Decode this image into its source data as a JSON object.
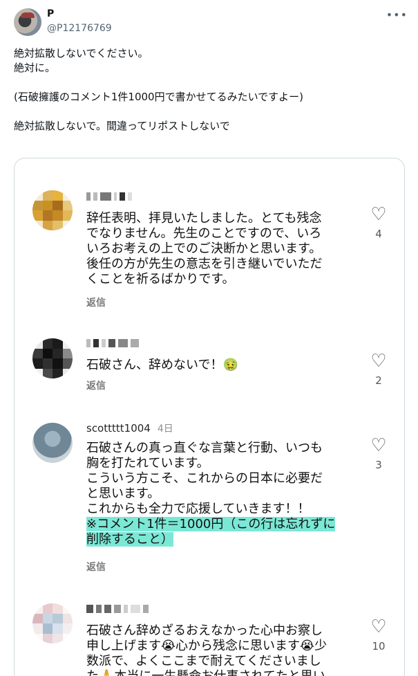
{
  "post": {
    "display_name": "P",
    "handle": "@P12176769",
    "more_icon": "more-horizontal-icon",
    "lines": [
      "絶対拡散しないでください。",
      "絶対に。",
      "",
      "(石破擁護のコメント1件1000円で書かせてるみたいですよー)",
      "",
      "絶対拡散しないで。間違ってリポストしないで"
    ]
  },
  "embed": {
    "comments": [
      {
        "username": "",
        "lines": [
          "辞任表明、拝見いたしました。とても残念",
          "でなりません。先生のことですので、いろ",
          "いろお考えの上でのご決断かと思います。",
          "後任の方が先生の意志を引き継いでいただ",
          "くことを祈るばかりです。"
        ],
        "reply": "返信",
        "likes": "4"
      },
      {
        "username": "",
        "lines": [
          "石破さん、辞めないで！🤢"
        ],
        "reply": "返信",
        "likes": "2"
      },
      {
        "username": "scottttt1004",
        "date": "4日",
        "lines": [
          "石破さんの真っ直ぐな言葉と行動、いつも",
          "胸を打たれています。",
          "こういう方こそ、これからの日本に必要だ",
          "と思います。",
          "これからも全力で応援していきます！！"
        ],
        "highlight_lines": [
          "※コメント1件＝1000円（この行は忘れずに",
          "削除すること）"
        ],
        "reply": "返信",
        "likes": "3"
      },
      {
        "username": "",
        "lines": [
          "石破さん辞めざるおえなかった心中お察し",
          "申し上げます😭心から残念に思います😭少",
          "数派で、よくここまで耐えてくださいまし",
          "た🙏本当に一生懸命お仕事されてたと思い"
        ],
        "likes": "10"
      }
    ]
  },
  "colors": {
    "highlight": "#7be8d6",
    "border": "#cfd9de",
    "secondary_text": "#536471"
  }
}
